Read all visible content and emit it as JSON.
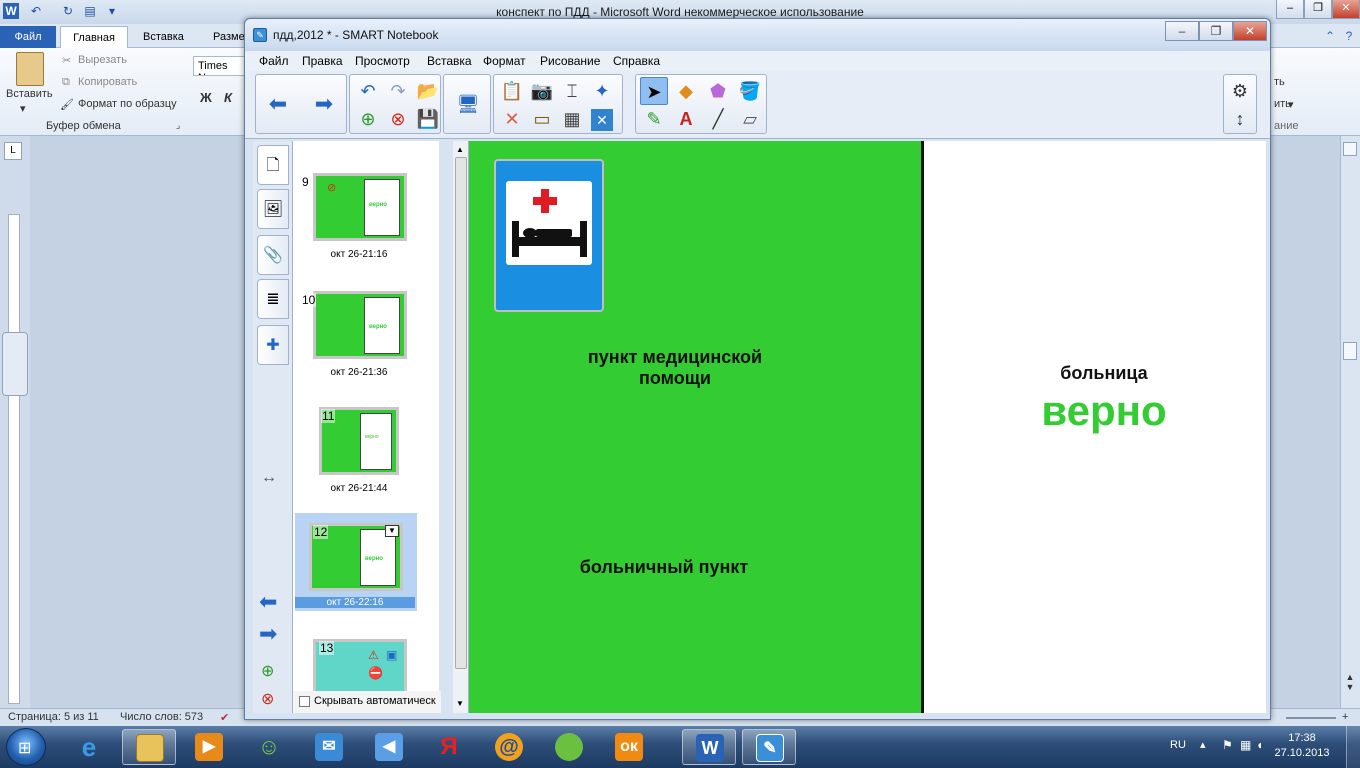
{
  "word": {
    "title": "конспект по ПДД - Microsoft Word некоммерческое использование",
    "tabs": {
      "file": "Файл",
      "home": "Главная",
      "insert": "Вставка",
      "layout": "Разме"
    },
    "ribbon": {
      "paste": "Вставить",
      "cut": "Вырезать",
      "copy": "Копировать",
      "format_painter": "Формат по образцу",
      "clipboard_group": "Буфер обмена",
      "font_name": "Times Ne",
      "bold": "Ж",
      "italic": "К",
      "right_fragment_1": "ть",
      "right_fragment_2": "ить",
      "right_fragment_3": "ание"
    },
    "status": {
      "page": "Страница: 5 из 11",
      "words": "Число слов: 573"
    }
  },
  "notebook": {
    "title": "пдд,2012 * - SMART Notebook",
    "menu": [
      "Файл",
      "Правка",
      "Просмотр",
      "Вставка",
      "Формат",
      "Рисование",
      "Справка"
    ],
    "thumbnails": [
      {
        "num": "9",
        "label": "окт 26-21:16",
        "right_text": "верно"
      },
      {
        "num": "10",
        "label": "окт 26-21:36",
        "right_text": "верно"
      },
      {
        "num": "11",
        "label": "окт 26-21:44",
        "right_text": "верно"
      },
      {
        "num": "12",
        "label": "окт 26-22:16",
        "right_text": "верно"
      },
      {
        "num": "13",
        "label": ""
      }
    ],
    "hide_auto": "Скрывать автоматическ",
    "page": {
      "answer_1": "пункт медицинской\nпомощи",
      "answer_2": "больничный пункт",
      "right_word": "больница",
      "verdict": "верно"
    }
  },
  "taskbar": {
    "lang": "RU",
    "time": "17:38",
    "date": "27.10.2013"
  },
  "colors": {
    "slide_green": "#33cc33",
    "verdict_green": "#33cc33",
    "sign_blue": "#1a8ee0",
    "cross_red": "#e01b24"
  }
}
